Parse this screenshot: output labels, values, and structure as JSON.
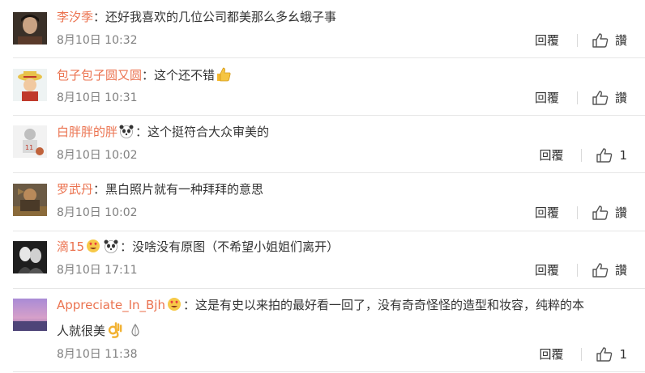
{
  "comments": [
    {
      "user": "李汐季",
      "text": "：还好我喜欢的几位公司都美那么多幺蛾子事",
      "time": "8月10日 10:32",
      "reply": "回覆",
      "like": "讚"
    },
    {
      "user": "包子包子圆又圆",
      "text": "：这个还不错",
      "time": "8月10日 10:31",
      "reply": "回覆",
      "like": "讚"
    },
    {
      "user": "白胖胖的胖",
      "text": "：这个挺符合大众审美的",
      "time": "8月10日 10:02",
      "reply": "回覆",
      "like": "1"
    },
    {
      "user": "罗武丹",
      "text": "：黑白照片就有一种拜拜的意思",
      "time": "8月10日 10:02",
      "reply": "回覆",
      "like": "讚"
    },
    {
      "user": "滴15",
      "text": "：没啥没有原图（不希望小姐姐们离开）",
      "time": "8月10日 17:11",
      "reply": "回覆",
      "like": "讚"
    },
    {
      "user": "Appreciate_In_Bjh",
      "text": "：这是有史以来拍的最好看一回了，没有奇奇怪怪的造型和妆容，纯粹的本",
      "text2": "人就很美",
      "time": "8月10日 11:38",
      "reply": "回覆",
      "like": "1"
    }
  ],
  "icons": {
    "like": "thumbs-up-icon",
    "emoji_thumb": "thumbs-up-emoji",
    "emoji_panda": "panda-emoji",
    "emoji_heart_eyes": "heart-eyes-emoji",
    "emoji_ok": "ok-hand-emoji",
    "emoji_pray": "pray-emoji"
  },
  "colors": {
    "username": "#eb7350",
    "time": "#808080",
    "divider": "#e6e6e6"
  }
}
